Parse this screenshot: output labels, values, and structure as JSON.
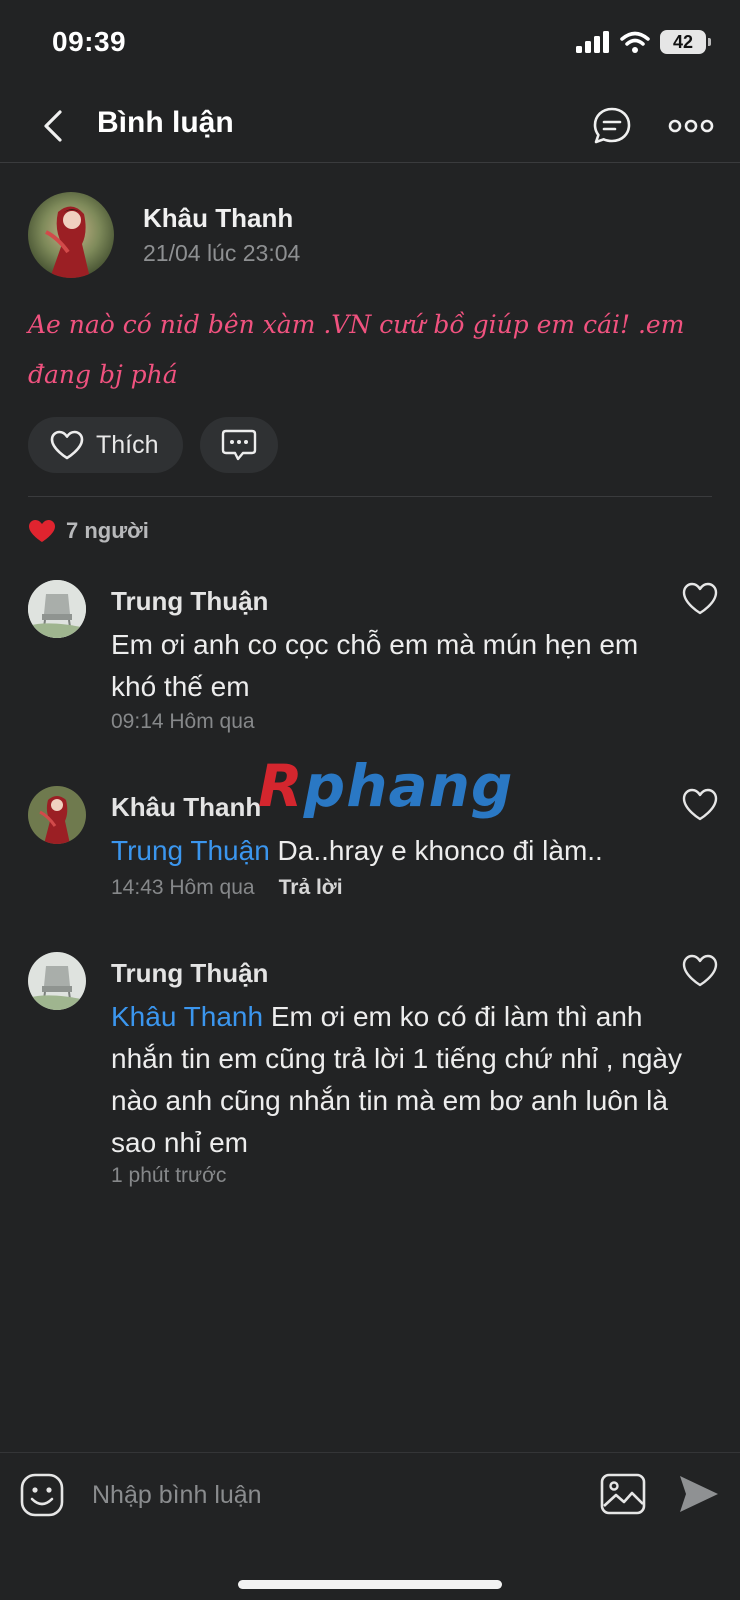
{
  "status_bar": {
    "time": "09:39",
    "battery": "42"
  },
  "header": {
    "title": "Bình luận"
  },
  "post": {
    "author": "Khâu Thanh",
    "timestamp": "21/04 lúc 23:04",
    "text": "Ae naò có nid bên xàm .VN cưứ bồ giúp em cái! .em đang bj phá",
    "like_label": "Thích",
    "reaction_count": "7 người",
    "reaction_color": "#e0242f"
  },
  "comments": [
    {
      "author": "Trung Thuận",
      "mention": "",
      "text": "Em ơi anh co cọc chỗ em mà mún hẹn em khó thế em",
      "time": "09:14 Hôm qua",
      "reply": ""
    },
    {
      "author": "Khâu Thanh",
      "mention": "Trung Thuận",
      "text": " Da..hray e khonco đi làm..",
      "time": "14:43 Hôm qua",
      "reply": "Trả lời"
    },
    {
      "author": "Trung Thuận",
      "mention": "Khâu Thanh",
      "text": " Em ơi em ko có đi làm thì anh nhắn tin em cũng trả lời 1 tiếng chứ nhỉ , ngày nào anh cũng nhắn tin mà em bơ anh luôn là sao nhỉ em",
      "time": "1 phút trước",
      "reply": ""
    }
  ],
  "watermark": {
    "part1": "R",
    "part2": "phang"
  },
  "input": {
    "placeholder": "Nhập bình luận"
  },
  "colors": {
    "background": "#222324",
    "mention": "#3b96ee",
    "post_text": "#f0527f"
  },
  "icons": [
    "back-arrow-icon",
    "chat-bubble-icon",
    "more-dots-icon",
    "heart-icon",
    "comment-icon",
    "emoji-icon",
    "image-icon",
    "send-icon"
  ]
}
